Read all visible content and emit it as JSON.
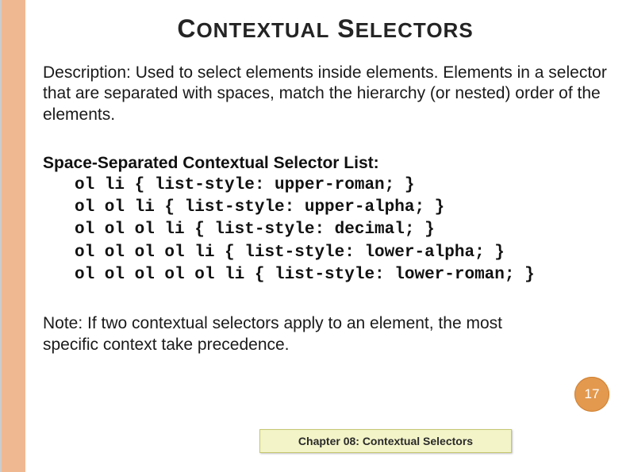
{
  "title": {
    "word1_cap": "C",
    "word1_rest": "ONTEXTUAL",
    "word2_cap": "S",
    "word2_rest": "ELECTORS"
  },
  "description": "Description: Used to select elements inside elements.  Elements in a selector that are separated with spaces, match the hierarchy (or nested) order of the elements.",
  "list_header": "Space-Separated Contextual Selector List:",
  "code_lines": [
    "ol li { list-style: upper-roman; }",
    "ol ol li { list-style: upper-alpha; }",
    "ol ol ol li { list-style: decimal; }",
    "ol ol ol ol li { list-style: lower-alpha; }",
    "ol ol ol ol ol li { list-style: lower-roman; }"
  ],
  "note": "Note: If two contextual selectors apply to an element, the most specific context take precedence.",
  "page_number": "17",
  "chapter_label": "Chapter  08: Contextual Selectors"
}
